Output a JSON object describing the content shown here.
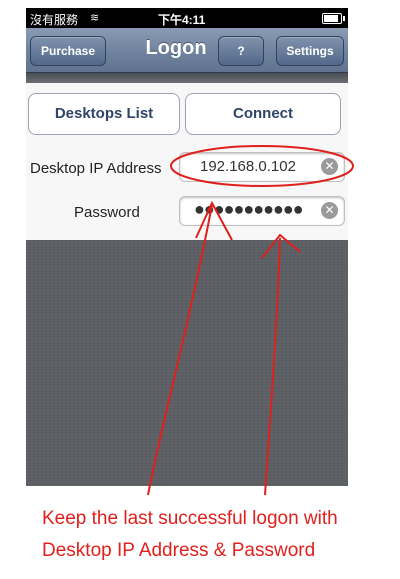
{
  "status_bar": {
    "carrier": "沒有服務",
    "time": "下午4:11",
    "wifi_icon": "wifi-icon",
    "battery_icon": "battery-charging-icon"
  },
  "navbar": {
    "purchase_label": "Purchase",
    "title": "Logon",
    "help_label": "?",
    "settings_label": "Settings"
  },
  "panel": {
    "desktops_list_label": "Desktops List",
    "connect_label": "Connect",
    "ip_label": "Desktop IP Address",
    "ip_value": "192.168.0.102",
    "password_label": "Password",
    "password_value": "●●●●●●●●●●●"
  },
  "annotation": {
    "color": "#e0201c",
    "line1": "Keep the last successful logon with",
    "line2": "Desktop IP Address & Password"
  }
}
